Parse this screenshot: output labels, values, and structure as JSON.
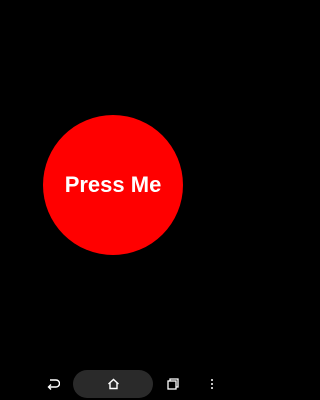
{
  "main": {
    "button_label": "Press Me",
    "button_color": "#ff0000",
    "background_color": "#000000"
  },
  "navbar": {
    "back_icon": "back-icon",
    "home_icon": "home-icon",
    "recents_icon": "recents-icon",
    "menu_icon": "overflow-menu-icon"
  }
}
